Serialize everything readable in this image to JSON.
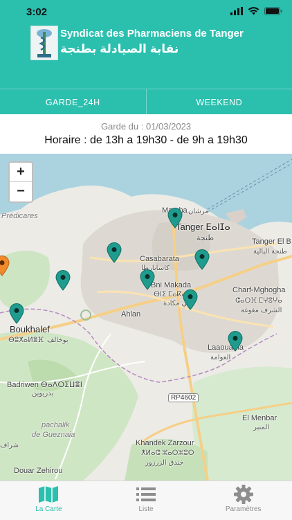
{
  "status_bar": {
    "time": "3:02"
  },
  "header": {
    "title_fr": "Syndicat des Pharmaciens de Tanger",
    "title_ar": "نقابة الصيادلة بطنجة",
    "tabs": [
      {
        "label": "GARDE_24H"
      },
      {
        "label": "WEEKEND"
      }
    ]
  },
  "schedule": {
    "garde_date": "Garde du : 01/03/2023",
    "horaire": "Horaire : de 13h a 19h30 - de 9h a 19h30"
  },
  "map": {
    "zoom_in": "+",
    "zoom_out": "−",
    "labels": {
      "predicares": "Prédicares",
      "marshan": "Marsha",
      "marshan_ar": "مرشان",
      "tanger": "Tanger ⴹⴰⵏⵊⴰ",
      "tanger_ar": "طنجة",
      "tanger_el": "Tanger El B",
      "tanger_el_ar": "طنجة البالية",
      "casabarata": "Casabarata",
      "casabarata_ar": "كاسابارطا",
      "beni_makada": "Bni Makada",
      "beni_makada_tf": "ⴱⵏⵉ ⵎⴰⴽⴰⴷⴰ",
      "beni_makada_ar": "بني مكادة",
      "charf": "Charf-Mghogha",
      "charf_tf": "ⵛⴰⵔⴼ ⵎⵖⵓⵖⴰ",
      "charf_ar": "الشرف مغوغة",
      "ahlan": "Ahlan",
      "boukhalef": "Boukhalef",
      "boukhalef_tf": "ⴱⵓⵅⴰⵍⴻⴼ",
      "boukhalef_ar": "بوخالف",
      "laaouama": "Laaouama",
      "laaouama_ar": "العوامة",
      "badriwen": "Badriwen ⴱⴰⴷⵔⵉⵡⴻⵏ",
      "badriwen_ar": "بدريوين",
      "road": "RP4602",
      "el_menbar": "El Menbar",
      "el_menbar_ar": "المنبر",
      "pachalik": "pachalik",
      "de_gueznaia": "de Gueznaia",
      "khandek": "Khandek Zarzour",
      "khandek_tf": "ⵅⵍⴰⵛ ⵣⴰⵔⵣⵓⵔ",
      "khandek_ar": "خندق الزرزور",
      "douar": "Douar Zehirou",
      "zone_ar": "شراف"
    }
  },
  "bottom_nav": {
    "items": [
      {
        "label": "La Carte"
      },
      {
        "label": "Liste"
      },
      {
        "label": "Paramètres"
      }
    ]
  },
  "colors": {
    "brand": "#2bbfae",
    "pin_teal": "#1f9c8e",
    "pin_orange": "#f08a2a",
    "sea": "#aad3df"
  }
}
